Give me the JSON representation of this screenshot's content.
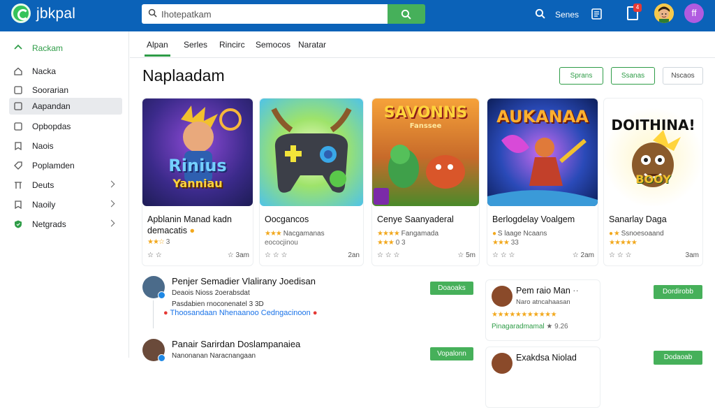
{
  "header": {
    "brand": "jbkpal",
    "search_placeholder": "Ihotepatkam",
    "link": "Senes",
    "notification_count": "4",
    "profile_initial": "ff"
  },
  "sidebar": {
    "items": [
      {
        "label": "Rackam",
        "icon": "home-icon"
      },
      {
        "label": "Nacka",
        "icon": "home-outline-icon"
      },
      {
        "label": "Soorarian",
        "icon": "square-icon"
      },
      {
        "label": "Aapandan",
        "icon": "square-icon"
      },
      {
        "label": "Opbopdas",
        "icon": "square-icon"
      },
      {
        "label": "Naois",
        "icon": "bookmark-icon"
      },
      {
        "label": "Poplamden",
        "icon": "tag-icon"
      },
      {
        "label": "Deuts",
        "icon": "filter-icon"
      },
      {
        "label": "Naoily",
        "icon": "bookmark-icon"
      },
      {
        "label": "Netgrads",
        "icon": "shield-icon"
      }
    ]
  },
  "tabs": [
    "Alpan",
    "Serles",
    "Rincirc",
    "Semocos",
    "Naratar"
  ],
  "page_title": "Naplaadam",
  "filters": [
    "Sprans",
    "Ssanas",
    "Nscaos"
  ],
  "cards": [
    {
      "thumb_title": "Rinius",
      "thumb_sub": "Yanniau",
      "title": "Apblanin Manad kadn",
      "title2": "demacatis",
      "sub": "",
      "rating": "3",
      "foot": "3am"
    },
    {
      "thumb_title": "",
      "thumb_sub": "",
      "title": "Oocgancos",
      "title2": "",
      "sub": "Nacgamanas",
      "rating": "eococjinou",
      "foot": "2an"
    },
    {
      "thumb_title": "SAVONNS",
      "thumb_sub": "Fanssee",
      "title": "Cenye Saanyaderal",
      "title2": "",
      "sub": "Fangamada",
      "rating": "0 3",
      "foot": "5m"
    },
    {
      "thumb_title": "AUKANAA",
      "thumb_sub": "",
      "title": "Berlogdelay Voalgem",
      "title2": "",
      "sub": "S laage Ncaans",
      "rating": "33",
      "foot": "2am"
    },
    {
      "thumb_title": "DOITHINA!",
      "thumb_sub": "BOOY",
      "title": "Sanarlay Daga",
      "title2": "",
      "sub": "Ssnoesoaand",
      "rating": "",
      "foot": "3am"
    }
  ],
  "reviews": [
    {
      "name": "Penjer Semadier Vlalirany Joedisan",
      "line1": "Deaois Nioss   2oerabsdat",
      "line2": "Pasdabien rnoconenatel 3 3D",
      "link": "Thoosandaan Nhenaanoo Cedngacinoon",
      "button": "Doaoaks"
    },
    {
      "name": "Panair Sarirdan Doslampanaiea",
      "line1": "Nanonanan Naracnangaan",
      "line2": "",
      "link": "",
      "button": "Vopalonn"
    }
  ],
  "side_cards": [
    {
      "name": "Pem raio Man",
      "line": "Naro atncahaasan",
      "stars": "★★★★★★★★★★★",
      "green": "Pinagaradmamal",
      "extra": "9.26",
      "button": "Dordirobb"
    },
    {
      "name": "Exakdsa Niolad",
      "line": "",
      "stars": "",
      "green": "",
      "extra": "",
      "button": "Dodaoab"
    }
  ]
}
